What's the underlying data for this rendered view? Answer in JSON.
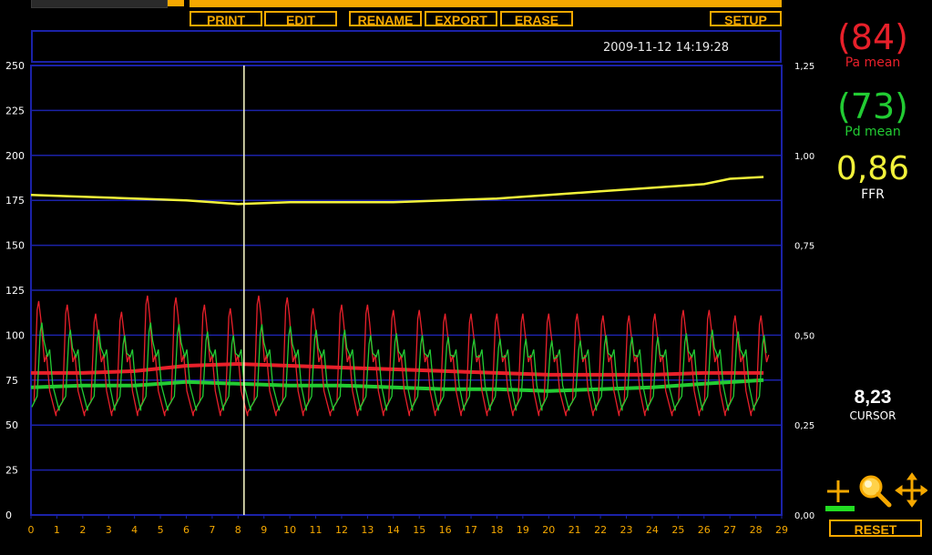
{
  "toolbar": {
    "print_label": "PRINT",
    "edit_label": "EDIT",
    "rename_label": "RENAME",
    "export_label": "EXPORT",
    "erase_label": "ERASE",
    "setup_label": "SETUP"
  },
  "header": {
    "datetime": "2009-11-12 14:19:28"
  },
  "readouts": {
    "pa_value": "(84)",
    "pa_label": "Pa mean",
    "pd_value": "(73)",
    "pd_label": "Pd mean",
    "ffr_value": "0,86",
    "ffr_label": "FFR",
    "cursor_value": "8,23",
    "cursor_label": "CURSOR"
  },
  "tools": {
    "icons": [
      "crosshair-icon",
      "magnifier-icon",
      "move-arrows-icon"
    ],
    "reset_label": "RESET"
  },
  "colors": {
    "accent": "#f5a800",
    "grid": "#1b22a8",
    "pa": "#e8202a",
    "pd": "#22cc33",
    "ffr": "#f2f23a",
    "cursor": "#ffffcc"
  },
  "chart_data": {
    "type": "line",
    "title": "",
    "xlabel": "",
    "ylabel": "",
    "x_ticks": [
      "0",
      "1",
      "2",
      "3",
      "4",
      "5",
      "6",
      "7",
      "8",
      "9",
      "10",
      "11",
      "12",
      "13",
      "14",
      "15",
      "16",
      "17",
      "18",
      "19",
      "20",
      "21",
      "22",
      "23",
      "24",
      "25",
      "26",
      "27",
      "28",
      "29"
    ],
    "xlim": [
      0,
      29
    ],
    "y_left_ticks": [
      "250",
      "225",
      "200",
      "175",
      "150",
      "125",
      "100",
      "75",
      "50",
      "25",
      "0"
    ],
    "ylim_left": [
      0,
      250
    ],
    "y_right_ticks": [
      "1,25",
      "1,00",
      "0,75",
      "0,50",
      "0,25",
      "0,00"
    ],
    "ylim_right": [
      0,
      1.25
    ],
    "cursor_x": 8.23,
    "series": [
      {
        "name": "Pa mean",
        "axis": "left",
        "x": [
          0,
          2,
          4,
          6,
          8,
          10,
          12,
          14,
          16,
          18,
          20,
          22,
          24,
          26,
          28.3
        ],
        "values": [
          79,
          79,
          80,
          83,
          84,
          83,
          82,
          81,
          80,
          79,
          78,
          78,
          78,
          79,
          79
        ]
      },
      {
        "name": "Pd mean",
        "axis": "left",
        "x": [
          0,
          2,
          4,
          6,
          8,
          10,
          12,
          14,
          16,
          18,
          20,
          22,
          24,
          26,
          28.3
        ],
        "values": [
          71,
          72,
          72,
          74,
          73,
          72,
          72,
          71,
          70,
          70,
          69,
          70,
          71,
          73,
          75
        ]
      },
      {
        "name": "FFR",
        "axis": "right",
        "x": [
          0,
          2,
          4,
          6,
          8,
          10,
          12,
          14,
          16,
          18,
          20,
          22,
          24,
          26,
          27,
          28.3
        ],
        "values": [
          0.89,
          0.885,
          0.88,
          0.875,
          0.865,
          0.87,
          0.87,
          0.87,
          0.875,
          0.88,
          0.89,
          0.9,
          0.91,
          0.92,
          0.935,
          0.94
        ]
      },
      {
        "name": "Pa",
        "axis": "left",
        "wave": true,
        "x": [
          0.3,
          1.4,
          2.5,
          3.5,
          4.5,
          5.6,
          6.7,
          7.7,
          8.8,
          9.9,
          10.9,
          12.0,
          13.0,
          14.0,
          15.0,
          16.0,
          17.0,
          18.0,
          19.0,
          20.0,
          21.1,
          22.1,
          23.1,
          24.1,
          25.2,
          26.2,
          27.2,
          28.2
        ],
        "values": [
          119,
          117,
          112,
          113,
          122,
          121,
          117,
          115,
          122,
          121,
          115,
          117,
          117,
          114,
          114,
          112,
          112,
          112,
          112,
          112,
          112,
          111,
          111,
          112,
          114,
          114,
          111,
          111
        ],
        "min": 55
      },
      {
        "name": "Pd",
        "axis": "left",
        "wave": true,
        "x": [
          0.3,
          1.4,
          2.5,
          3.5,
          4.5,
          5.6,
          6.7,
          7.7,
          8.8,
          9.9,
          10.9,
          12.0,
          13.0,
          14.0,
          15.0,
          16.0,
          17.0,
          18.0,
          19.0,
          20.0,
          21.1,
          22.1,
          23.1,
          24.1,
          25.2,
          26.2,
          27.2,
          28.2
        ],
        "values": [
          107,
          103,
          103,
          100,
          107,
          106,
          102,
          100,
          106,
          105,
          103,
          103,
          100,
          101,
          100,
          99,
          98,
          98,
          98,
          97,
          97,
          100,
          99,
          99,
          101,
          103,
          102,
          100
        ],
        "min": 58
      }
    ]
  }
}
